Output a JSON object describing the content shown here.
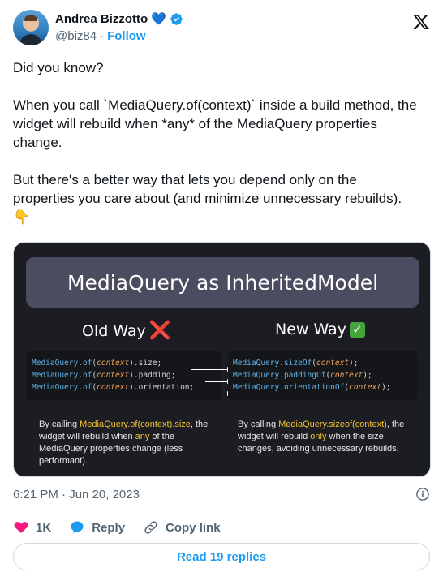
{
  "author": {
    "name": "Andrea Bizzotto",
    "handle": "@biz84",
    "separator": "·",
    "follow_label": "Follow"
  },
  "tweet": {
    "lines": [
      "Did you know?",
      "When you call `MediaQuery.of(context)` inside a build method, the widget will rebuild when *any* of the MediaQuery properties change.",
      "But there's a better way that lets you depend only on the properties you care about (and minimize unnecessary rebuilds). "
    ],
    "emoji": "👇"
  },
  "media": {
    "title": "MediaQuery as InheritedModel",
    "old_heading": "Old Way",
    "old_mark": "❌",
    "new_heading": "New Way",
    "new_mark": "✓",
    "old_code": [
      {
        "cls": "MediaQuery",
        "p1": ".",
        "fn": "of",
        "p2": "(",
        "arg": "context",
        "p3": ").size;"
      },
      {
        "cls": "MediaQuery",
        "p1": ".",
        "fn": "of",
        "p2": "(",
        "arg": "context",
        "p3": ").padding;"
      },
      {
        "cls": "MediaQuery",
        "p1": ".",
        "fn": "of",
        "p2": "(",
        "arg": "context",
        "p3": ").orientation;"
      }
    ],
    "new_code": [
      {
        "cls": "MediaQuery",
        "p1": ".",
        "fn": "sizeOf",
        "p2": "(",
        "arg": "context",
        "p3": ");"
      },
      {
        "cls": "MediaQuery",
        "p1": ".",
        "fn": "paddingOf",
        "p2": "(",
        "arg": "context",
        "p3": ");"
      },
      {
        "cls": "MediaQuery",
        "p1": ".",
        "fn": "orientationOf",
        "p2": "(",
        "arg": "context",
        "p3": ");"
      }
    ],
    "old_desc": {
      "a": "By calling ",
      "b": "MediaQuery.of(context).size",
      "c": ", the widget will rebuild when ",
      "d": "any",
      "e": " of the MediaQuery properties change (less performant)."
    },
    "new_desc": {
      "a": "By calling ",
      "b": "MediaQuery.sizeof(context)",
      "c": ", the widget will rebuild ",
      "d": "only",
      "e": " when the size changes, avoiding unnecessary rebuilds."
    }
  },
  "meta": {
    "timestamp": "6:21 PM · Jun 20, 2023"
  },
  "actions": {
    "likes": "1K",
    "reply_label": "Reply",
    "copy_label": "Copy link"
  },
  "read_replies_label": "Read 19 replies",
  "colors": {
    "accent": "#1d9bf0",
    "like": "#f91880",
    "media_bg": "#1c1d22"
  }
}
